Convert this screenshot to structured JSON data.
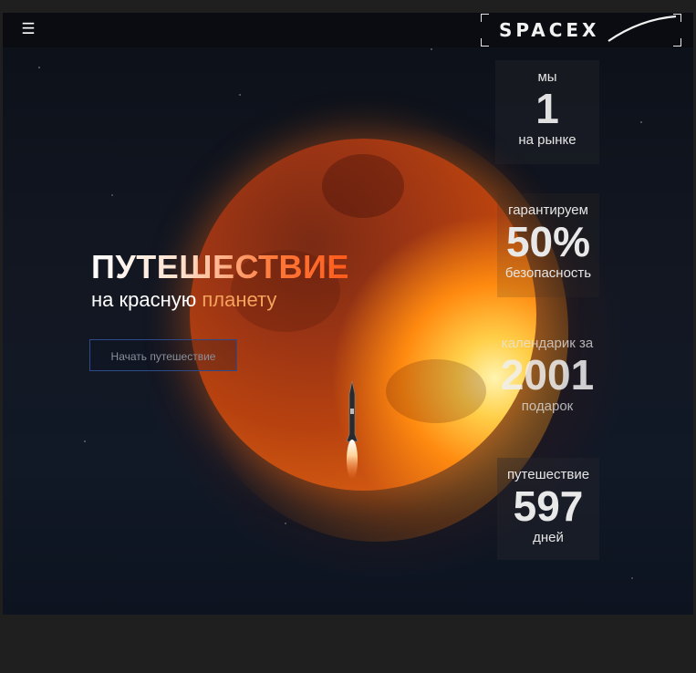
{
  "header": {
    "menu_icon": "☰",
    "logo_text": "SPACEX"
  },
  "hero": {
    "title": "ПУТЕШЕСТВИЕ",
    "subtitle_start": "на красную ",
    "subtitle_accent": "планету",
    "cta_label": "Начать путешествие"
  },
  "stats": [
    {
      "label": "мы",
      "value": "1",
      "caption": "на рынке"
    },
    {
      "label": "гарантируем",
      "value": "50%",
      "caption": "безопасность"
    },
    {
      "label": "календарик за",
      "value": "2001",
      "caption": "подарок"
    },
    {
      "label": "путешествие",
      "value": "597",
      "caption": "дней"
    }
  ],
  "colors": {
    "accent_orange": "#ff5a1a",
    "button_border": "#2d4b8a",
    "background": "#1f1f1f"
  }
}
